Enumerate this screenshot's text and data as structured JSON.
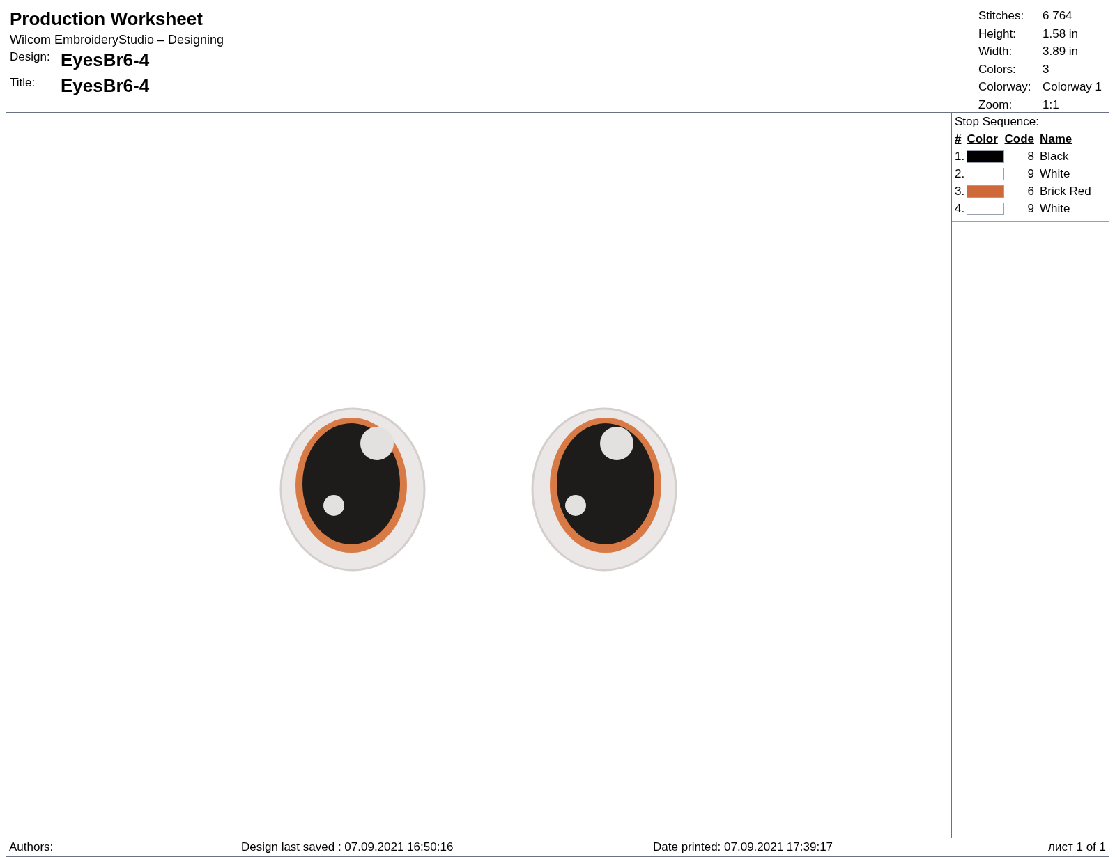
{
  "header": {
    "title": "Production Worksheet",
    "subtitle": "Wilcom EmbroideryStudio – Designing",
    "fields": [
      {
        "label": "Design:",
        "value": "EyesBr6-4"
      },
      {
        "label": "Title:",
        "value": "EyesBr6-4"
      }
    ]
  },
  "info": [
    {
      "label": "Stitches:",
      "value": "6 764"
    },
    {
      "label": "Height:",
      "value": "1.58 in"
    },
    {
      "label": "Width:",
      "value": "3.89 in"
    },
    {
      "label": "Colors:",
      "value": "3"
    },
    {
      "label": "Colorway:",
      "value": "Colorway 1"
    },
    {
      "label": "Zoom:",
      "value": "1:1"
    }
  ],
  "stop_sequence": {
    "title": "Stop Sequence:",
    "columns": [
      "#",
      "Color",
      "Code",
      "Name"
    ],
    "rows": [
      {
        "index": "1.",
        "color": "#000000",
        "code": "8",
        "name": "Black"
      },
      {
        "index": "2.",
        "color": "#ffffff",
        "code": "9",
        "name": "White"
      },
      {
        "index": "3.",
        "color": "#d0693a",
        "code": "6",
        "name": "Brick Red"
      },
      {
        "index": "4.",
        "color": "#ffffff",
        "code": "9",
        "name": "White"
      }
    ]
  },
  "footer": {
    "authors": "Authors:",
    "saved": "Design last saved : 07.09.2021 16:50:16",
    "printed": "Date printed: 07.09.2021 17:39:17",
    "page": "лист 1 of 1"
  }
}
